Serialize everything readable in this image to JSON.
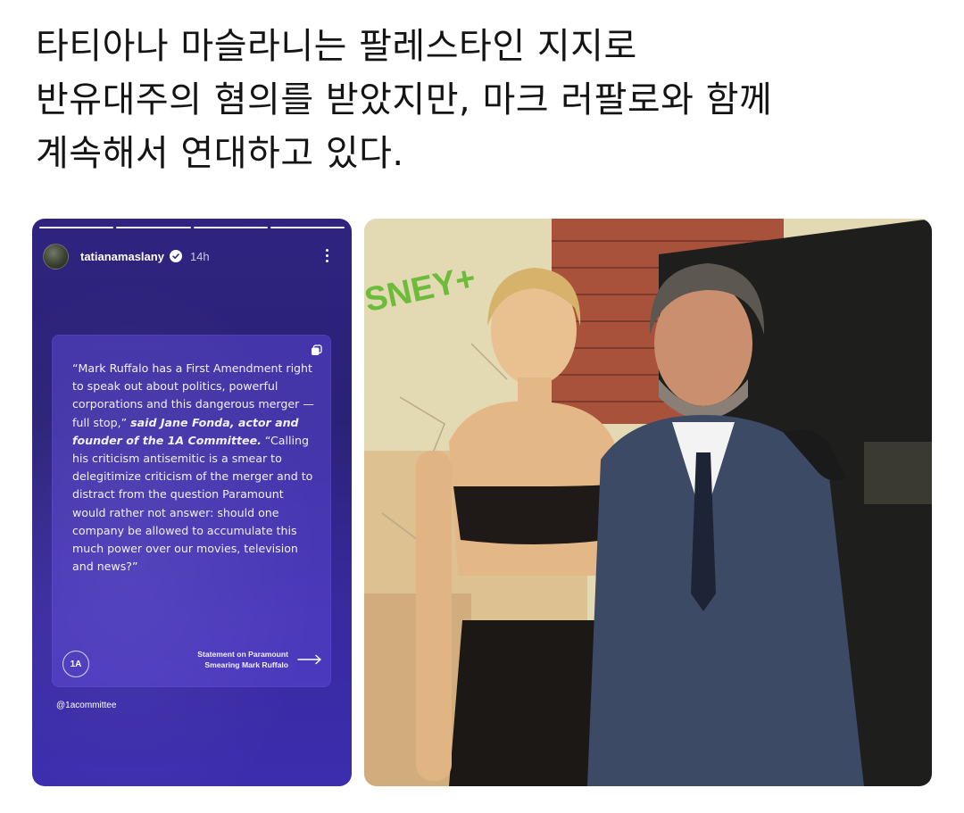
{
  "headline": {
    "lines": [
      "타티아나 마슬라니는 팔레스타인 지지로",
      "반유대주의 혐의를 받았지만, 마크 러팔로와 함께",
      "계속해서 연대하고 있다."
    ]
  },
  "story": {
    "username": "tatianamaslany",
    "time": "14h",
    "quote_intro": "“Mark Ruffalo has a First Amendment right to speak out about politics, powerful corporations and this dangerous merger — full stop,” ",
    "quote_bold": "said Jane Fonda, actor and founder of the 1A Committee.",
    "quote_rest": " “Calling his criticism antisemitic is a smear to delegitimize criticism of the merger and to distract from the question Paramount would rather not answer: should one company be allowed to accumulate this much power over our movies, television and news?”",
    "badge_text": "1A",
    "statement_line1": "Statement on Paramount",
    "statement_line2": "Smearing Mark Ruffalo",
    "handle": "@1acommittee",
    "progress": {
      "segments": 4,
      "completed": 4
    }
  },
  "photo": {
    "backdrop_sign": "SNEY+"
  },
  "colors": {
    "story_bg": "#2f237f",
    "story_card": "#5a46d2",
    "text_dark": "#141414"
  }
}
